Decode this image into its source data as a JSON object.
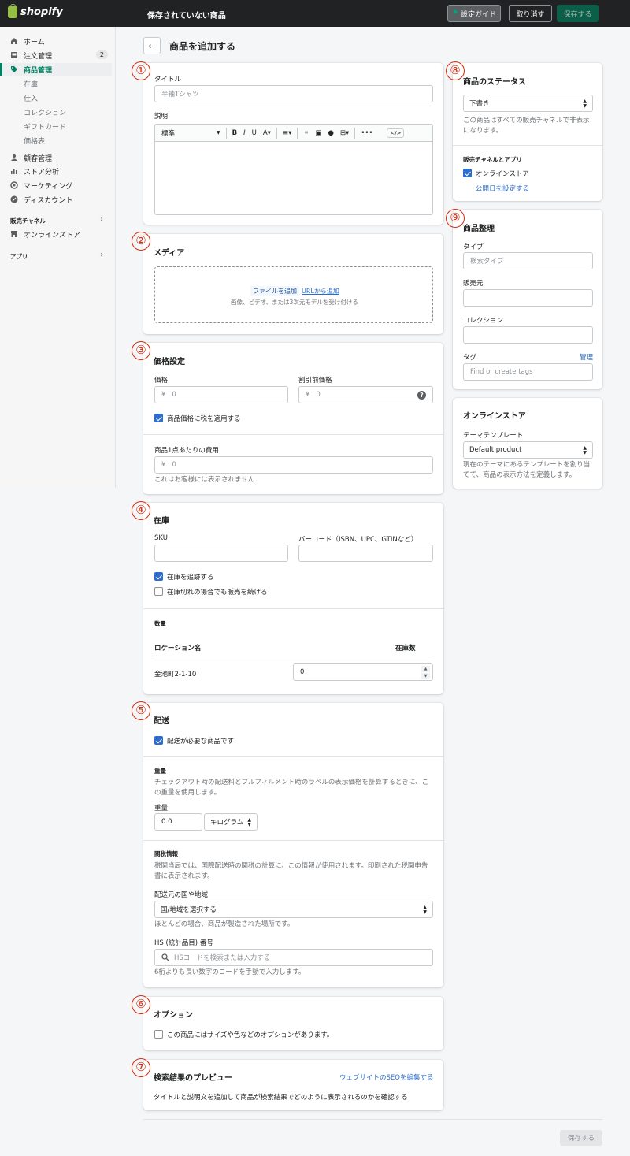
{
  "topbar": {
    "brand": "shopify",
    "title": "保存されていない商品",
    "guide_label": "設定ガイド",
    "discard_label": "取り消す",
    "save_label": "保存する"
  },
  "sidebar": {
    "items": [
      {
        "label": "ホーム",
        "icon": "home-icon"
      },
      {
        "label": "注文管理",
        "icon": "orders-icon",
        "badge": "2"
      },
      {
        "label": "商品管理",
        "icon": "tag-icon"
      },
      {
        "label": "顧客管理",
        "icon": "customer-icon"
      },
      {
        "label": "ストア分析",
        "icon": "analytics-icon"
      },
      {
        "label": "マーケティング",
        "icon": "marketing-icon"
      },
      {
        "label": "ディスカウント",
        "icon": "discount-icon"
      },
      {
        "label": "オンラインストア",
        "icon": "store-icon"
      }
    ],
    "sub_items": [
      "在庫",
      "仕入",
      "コレクション",
      "ギフトカード",
      "価格表"
    ],
    "channels_heading": "販売チャネル",
    "apps_heading": "アプリ"
  },
  "page": {
    "title": "商品を追加する",
    "footer_save_label": "保存する"
  },
  "annotations": [
    "①",
    "②",
    "③",
    "④",
    "⑤",
    "⑥",
    "⑦",
    "⑧",
    "⑨"
  ],
  "title_card": {
    "title_label": "タイトル",
    "title_placeholder": "半袖Tシャツ",
    "description_label": "説明",
    "format_select": "標準"
  },
  "media": {
    "heading": "メディア",
    "add_file": "ファイルを追加",
    "add_url": "URLから追加",
    "hint": "画像、ビデオ、または3次元モデルを受け付ける"
  },
  "pricing": {
    "heading": "価格設定",
    "price_label": "価格",
    "compare_label": "割引前価格",
    "currency": "¥",
    "price_value": "0",
    "compare_value": "0",
    "tax_label": "商品価格に税を適用する",
    "cost_label": "商品1点あたりの費用",
    "cost_value": "0",
    "cost_hint": "これはお客様には表示されません"
  },
  "inventory": {
    "heading": "在庫",
    "sku_label": "SKU",
    "barcode_label": "バーコード（ISBN、UPC、GTINなど）",
    "track_label": "在庫を追跡する",
    "continue_label": "在庫切れの場合でも販売を続ける",
    "quantity_heading": "数量",
    "location_col": "ロケーション名",
    "stock_col": "在庫数",
    "location_name": "金池町2-1-10",
    "stock_value": "0"
  },
  "shipping": {
    "heading": "配送",
    "physical_label": "配送が必要な商品です",
    "weight_heading": "重量",
    "weight_desc": "チェックアウト時の配送料とフルフィルメント時のラベルの表示価格を計算するときに、この重量を使用します。",
    "weight_label": "重量",
    "weight_value": "0.0",
    "weight_unit": "キログラム",
    "customs_heading": "関税情報",
    "customs_desc": "税関当局では、国際配送時の関税の計算に、この情報が使用されます。印刷された税関申告書に表示されます。",
    "origin_label": "配送元の国や地域",
    "origin_value": "国/地域を選択する",
    "origin_hint": "ほとんどの場合、商品が製造された場所です。",
    "hs_label": "HS (統計品目) 番号",
    "hs_placeholder": "HSコードを検索または入力する",
    "hs_hint": "6桁よりも長い数字のコードを手動で入力します。"
  },
  "options": {
    "heading": "オプション",
    "checkbox_label": "この商品にはサイズや色などのオプションがあります。"
  },
  "seo": {
    "heading": "検索結果のプレビュー",
    "edit_link": "ウェブサイトのSEOを編集する",
    "desc": "タイトルと説明文を追加して商品が検索結果でどのように表示されるのかを確認する"
  },
  "status": {
    "heading": "商品のステータス",
    "value": "下書き",
    "desc": "この商品はすべての販売チャネルで非表示になります。",
    "channels_heading": "販売チャネルとアプリ",
    "channel_name": "オンラインストア",
    "schedule_link": "公開日を設定する"
  },
  "organization": {
    "heading": "商品整理",
    "type_label": "タイプ",
    "type_placeholder": "検索タイプ",
    "vendor_label": "販売元",
    "collection_label": "コレクション",
    "tags_label": "タグ",
    "tags_manage": "管理",
    "tags_placeholder": "Find or create tags"
  },
  "online_store": {
    "heading": "オンラインストア",
    "template_label": "テーマテンプレート",
    "template_value": "Default product",
    "desc": "現在のテーマにあるテンプレートを割り当てて、商品の表示方法を定義します。"
  },
  "colors": {
    "accent": "#008060",
    "link": "#2c6ecb",
    "annotation": "#d72c0d",
    "topbar": "#202223"
  }
}
